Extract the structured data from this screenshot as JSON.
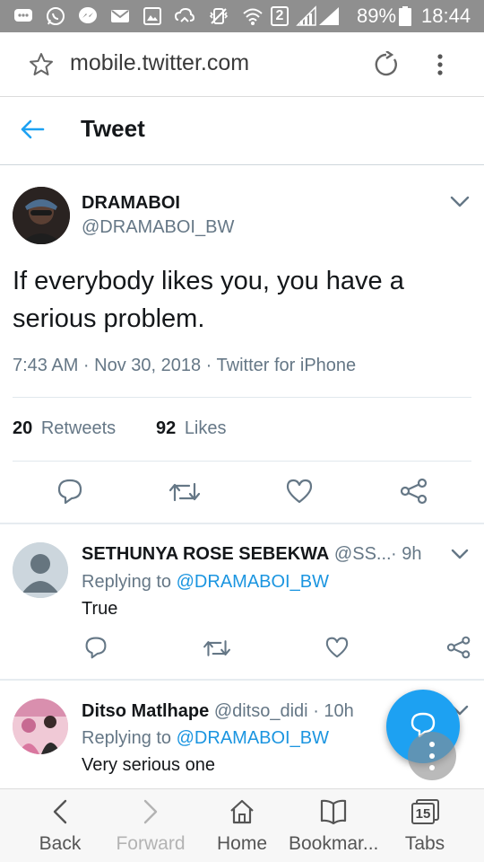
{
  "status_bar": {
    "battery": "89%",
    "time": "18:44",
    "sim_badge": "2"
  },
  "browser": {
    "url": "mobile.twitter.com"
  },
  "header": {
    "title": "Tweet"
  },
  "tweet": {
    "author_name": "DRAMABOI",
    "author_handle": "@DRAMABOI_BW",
    "text_line1": "If everybody likes you, you have a",
    "text_line2": "serious problem.",
    "meta": "7:43 AM · Nov 30, 2018 · Twitter for iPhone",
    "retweets_count": "20",
    "retweets_label": "Retweets",
    "likes_count": "92",
    "likes_label": "Likes"
  },
  "replies": [
    {
      "name": "SETHUNYA ROSE SEBEKWA",
      "handle": "@SS...",
      "time": "· 9h",
      "replying_prefix": "Replying to",
      "replying_to": "@DRAMABOI_BW",
      "text": "True"
    },
    {
      "name": "Ditso Matlhape",
      "handle": "@ditso_didi",
      "time": "· 10h",
      "replying_prefix": "Replying to",
      "replying_to": "@DRAMABOI_BW",
      "text": "Very serious one"
    }
  ],
  "bottom_nav": {
    "back": "Back",
    "forward": "Forward",
    "home": "Home",
    "bookmarks": "Bookmar...",
    "tabs": "Tabs",
    "tabs_count": "15"
  },
  "colors": {
    "accent": "#1da1f2",
    "link": "#1b95e0",
    "muted": "#657786",
    "statusbar": "#8f8f8f"
  }
}
